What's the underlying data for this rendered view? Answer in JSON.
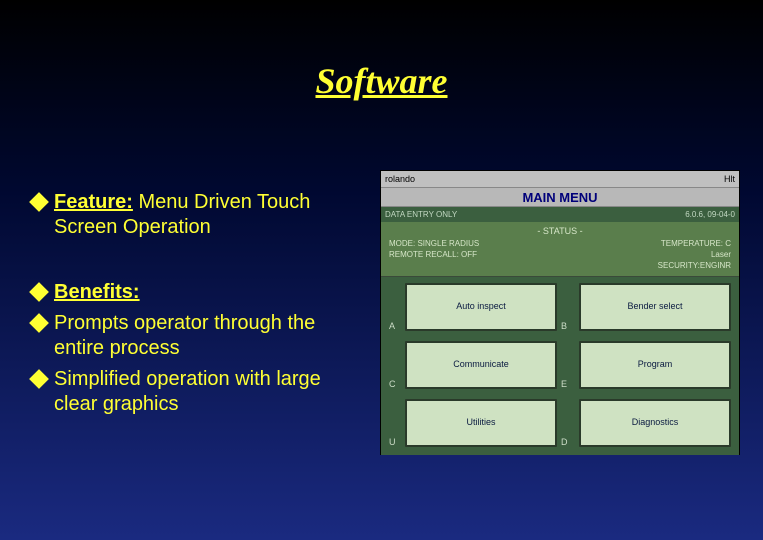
{
  "title": "Software",
  "left": {
    "feature_label": "Feature:",
    "feature_text": "  Menu Driven Touch Screen Operation",
    "benefits_label": "Benefits:",
    "benefit1": "Prompts operator through the entire process",
    "benefit2": "Simplified operation with large clear graphics"
  },
  "screenshot": {
    "titlebar_left": "rolando",
    "titlebar_right": "Hlt",
    "menubar": "MAIN MENU",
    "info_left": "DATA ENTRY ONLY",
    "info_right": "6.0.6, 09-04-0",
    "status_title": "- STATUS -",
    "status": {
      "l1": "MODE: SINGLE RADIUS",
      "r1": "TEMPERATURE: C",
      "l2": "REMOTE RECALL: OFF",
      "r2": "Laser",
      "l3": "",
      "r3": "SECURITY:ENGINR"
    },
    "rows": [
      "A",
      "B",
      "C",
      "E",
      "U",
      "D"
    ],
    "buttons": {
      "b1": "Auto inspect",
      "b2": "Bender select",
      "b3": "Communicate",
      "b4": "Program",
      "b5": "Utilities",
      "b6": "Diagnostics"
    }
  }
}
